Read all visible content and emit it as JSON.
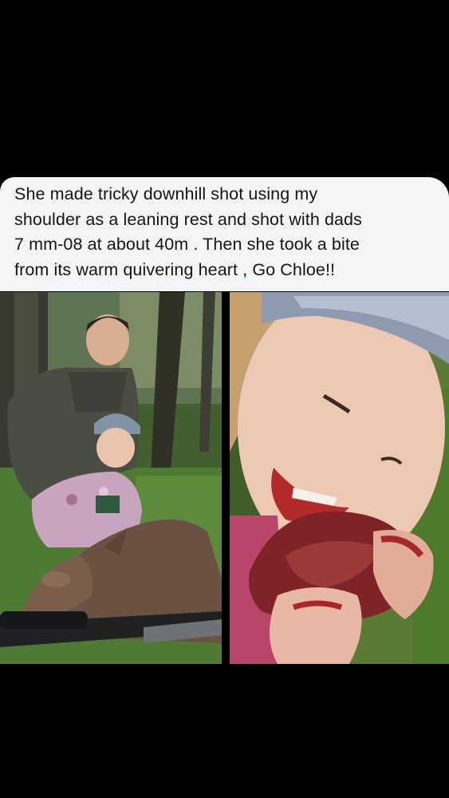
{
  "caption": {
    "lines": [
      "She made  tricky downhill shot using my",
      "shoulder as a leaning rest and shot with dads",
      "7 mm-08 at about 40m . Then she took a bite",
      "from its warm quivering heart , Go Chloe!!"
    ]
  },
  "colors": {
    "background": "#000000",
    "caption_background": "#f4f5f7",
    "caption_text": "#151515"
  }
}
